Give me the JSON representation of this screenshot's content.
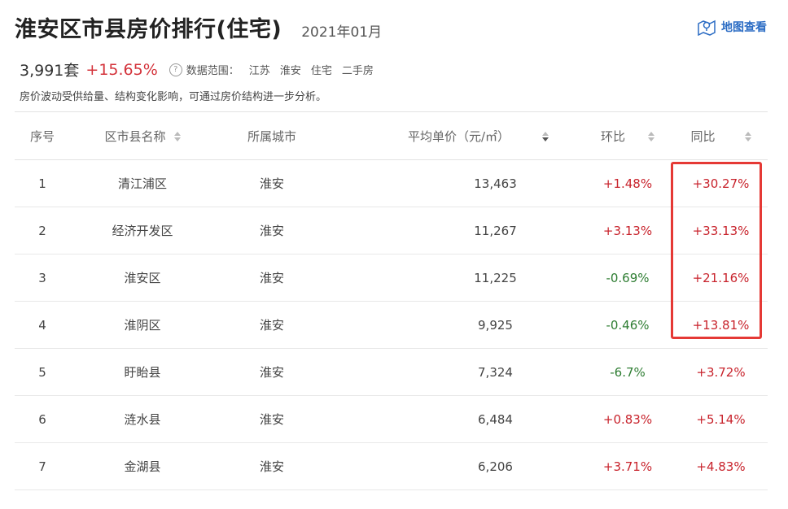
{
  "header": {
    "title": "淮安区市县房价排行(住宅)",
    "date": "2021年01月",
    "map_link": "地图查看"
  },
  "stats": {
    "count": "3,991套",
    "change": "+15.65%",
    "help": "?",
    "scope_label": "数据范围：",
    "scope": [
      "江苏",
      "淮安",
      "住宅",
      "二手房"
    ]
  },
  "description": "房价波动受供给量、结构变化影响，可通过房价结构进一步分析。",
  "table": {
    "headers": [
      "序号",
      "区市县名称",
      "所属城市",
      "平均单价（元/㎡）",
      "环比",
      "同比"
    ],
    "rows": [
      {
        "rank": "1",
        "name": "清江浦区",
        "city": "淮安",
        "price": "13,463",
        "mom": "+1.48%",
        "yoy": "+30.27%"
      },
      {
        "rank": "2",
        "name": "经济开发区",
        "city": "淮安",
        "price": "11,267",
        "mom": "+3.13%",
        "yoy": "+33.13%"
      },
      {
        "rank": "3",
        "name": "淮安区",
        "city": "淮安",
        "price": "11,225",
        "mom": "-0.69%",
        "yoy": "+21.16%"
      },
      {
        "rank": "4",
        "name": "淮阴区",
        "city": "淮安",
        "price": "9,925",
        "mom": "-0.46%",
        "yoy": "+13.81%"
      },
      {
        "rank": "5",
        "name": "盱眙县",
        "city": "淮安",
        "price": "7,324",
        "mom": "-6.7%",
        "yoy": "+3.72%"
      },
      {
        "rank": "6",
        "name": "涟水县",
        "city": "淮安",
        "price": "6,484",
        "mom": "+0.83%",
        "yoy": "+5.14%"
      },
      {
        "rank": "7",
        "name": "金湖县",
        "city": "淮安",
        "price": "6,206",
        "mom": "+3.71%",
        "yoy": "+4.83%"
      }
    ]
  },
  "colors": {
    "positive": "#c8232c",
    "negative": "#2e7d32",
    "highlight": "#e53935",
    "link": "#2b6cc4"
  }
}
